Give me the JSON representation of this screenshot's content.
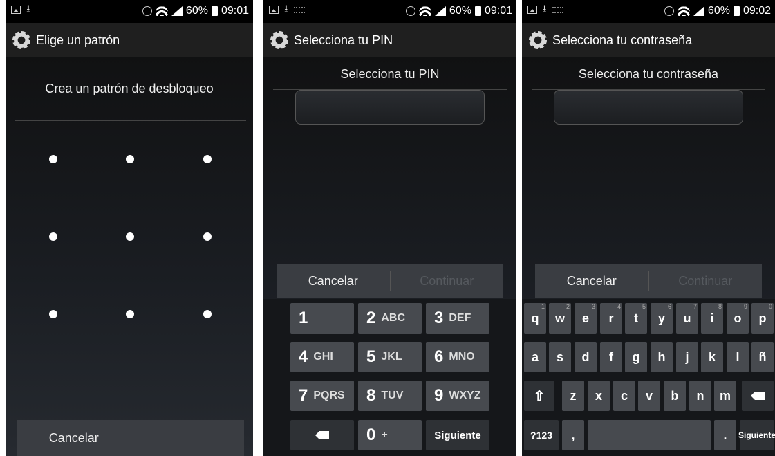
{
  "status": [
    {
      "battery": "60%",
      "time": "09:01"
    },
    {
      "battery": "60%",
      "time": "09:01"
    },
    {
      "battery": "60%",
      "time": "09:02"
    }
  ],
  "pattern": {
    "title": "Elige un patrón",
    "prompt": "Crea un patrón de desbloqueo",
    "cancel": "Cancelar"
  },
  "pin": {
    "title": "Selecciona tu PIN",
    "prompt": "Selecciona tu PIN",
    "cancel": "Cancelar",
    "continue": "Continuar",
    "keys": [
      {
        "d": "1",
        "l": ""
      },
      {
        "d": "2",
        "l": "ABC"
      },
      {
        "d": "3",
        "l": "DEF"
      },
      {
        "d": "4",
        "l": "GHI"
      },
      {
        "d": "5",
        "l": "JKL"
      },
      {
        "d": "6",
        "l": "MNO"
      },
      {
        "d": "7",
        "l": "PQRS"
      },
      {
        "d": "8",
        "l": "TUV"
      },
      {
        "d": "9",
        "l": "WXYZ"
      },
      {
        "d": "0",
        "l": "+"
      }
    ],
    "next": "Siguiente"
  },
  "password": {
    "title": "Selecciona tu contraseña",
    "prompt": "Selecciona tu contraseña",
    "cancel": "Cancelar",
    "continue": "Continuar",
    "row1": [
      "q",
      "w",
      "e",
      "r",
      "t",
      "y",
      "u",
      "i",
      "o",
      "p"
    ],
    "row1_hints": [
      "1",
      "2",
      "3",
      "4",
      "5",
      "6",
      "7",
      "8",
      "9",
      "0"
    ],
    "row2": [
      "a",
      "s",
      "d",
      "f",
      "g",
      "h",
      "j",
      "k",
      "l",
      "ñ"
    ],
    "row3": [
      "z",
      "x",
      "c",
      "v",
      "b",
      "n",
      "m"
    ],
    "sym": "?123",
    "comma": ",",
    "period": ".",
    "next": "Siguiente"
  },
  "icons": {
    "settings": "gear-icon",
    "backspace": "backspace-icon",
    "shift": "shift-icon"
  }
}
